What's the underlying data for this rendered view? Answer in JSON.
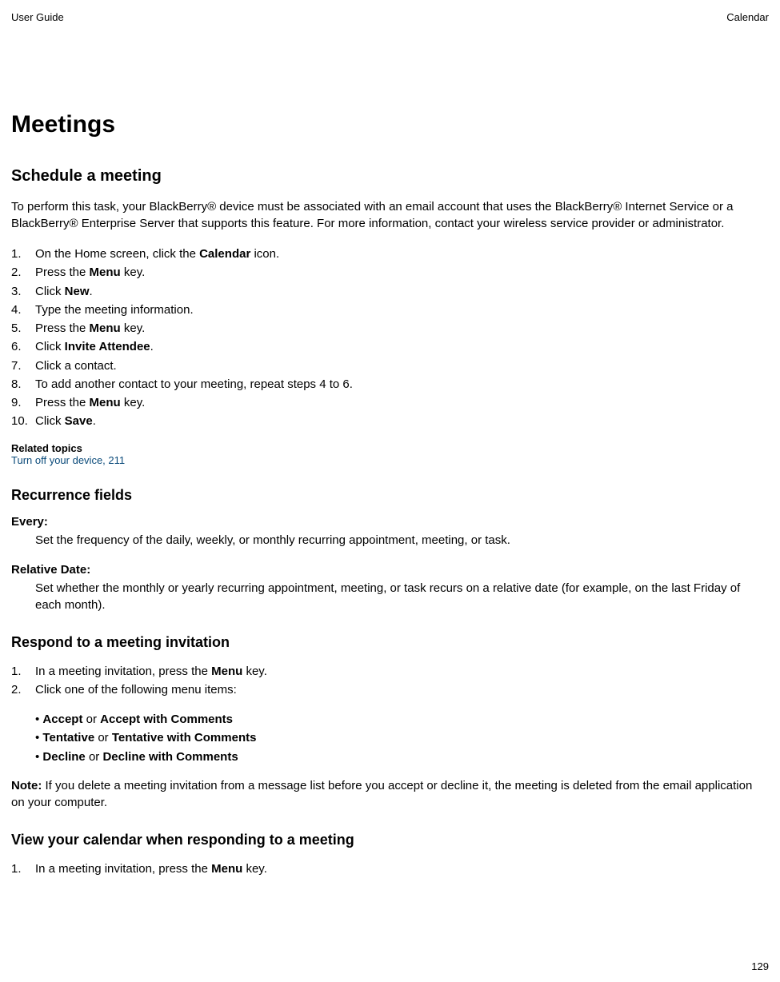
{
  "header": {
    "left": "User Guide",
    "right": "Calendar"
  },
  "h1": "Meetings",
  "schedule": {
    "title": "Schedule a meeting",
    "intro": "To perform this task, your BlackBerry® device must be associated with an email account that uses the BlackBerry® Internet Service or a BlackBerry® Enterprise Server that supports this feature. For more information, contact your wireless service provider or administrator.",
    "steps": [
      {
        "n": "1.",
        "pre": "On the Home screen, click the ",
        "b": "Calendar",
        "post": " icon."
      },
      {
        "n": "2.",
        "pre": "Press the ",
        "b": "Menu",
        "post": " key."
      },
      {
        "n": "3.",
        "pre": "Click ",
        "b": "New",
        "post": "."
      },
      {
        "n": "4.",
        "pre": "Type the meeting information.",
        "b": "",
        "post": ""
      },
      {
        "n": "5.",
        "pre": "Press the ",
        "b": "Menu",
        "post": " key."
      },
      {
        "n": "6.",
        "pre": "Click ",
        "b": "Invite Attendee",
        "post": "."
      },
      {
        "n": "7.",
        "pre": "Click a contact.",
        "b": "",
        "post": ""
      },
      {
        "n": "8.",
        "pre": "To add another contact to your meeting, repeat steps 4 to 6.",
        "b": "",
        "post": ""
      },
      {
        "n": "9.",
        "pre": "Press the ",
        "b": "Menu",
        "post": " key."
      },
      {
        "n": "10.",
        "pre": "Click ",
        "b": "Save",
        "post": "."
      }
    ],
    "related_label": "Related topics",
    "related_link": "Turn off your device, 211"
  },
  "recurrence": {
    "title": "Recurrence fields",
    "every_label": "Every:",
    "every_desc": "Set the frequency of the daily, weekly, or monthly recurring appointment, meeting, or task.",
    "relative_label": "Relative Date:",
    "relative_desc": "Set whether the monthly or yearly recurring appointment, meeting, or task recurs on a relative date (for example, on the last Friday of each month)."
  },
  "respond": {
    "title": "Respond to a meeting invitation",
    "steps": [
      {
        "n": "1.",
        "pre": "In a meeting invitation, press the ",
        "b": "Menu",
        "post": " key."
      },
      {
        "n": "2.",
        "pre": "Click one of the following menu items:",
        "b": "",
        "post": ""
      }
    ],
    "bullets": [
      {
        "b1": "Accept",
        "mid": " or ",
        "b2": "Accept with Comments"
      },
      {
        "b1": "Tentative",
        "mid": " or ",
        "b2": "Tentative with Comments"
      },
      {
        "b1": "Decline",
        "mid": " or ",
        "b2": "Decline with Comments"
      }
    ],
    "note_label": "Note:",
    "note_text": "  If you delete a meeting invitation from a message list before you accept or decline it, the meeting is deleted from the email application on your computer."
  },
  "view": {
    "title": "View your calendar when responding to a meeting",
    "steps": [
      {
        "n": "1.",
        "pre": "In a meeting invitation, press the ",
        "b": "Menu",
        "post": " key."
      }
    ]
  },
  "page_number": "129"
}
